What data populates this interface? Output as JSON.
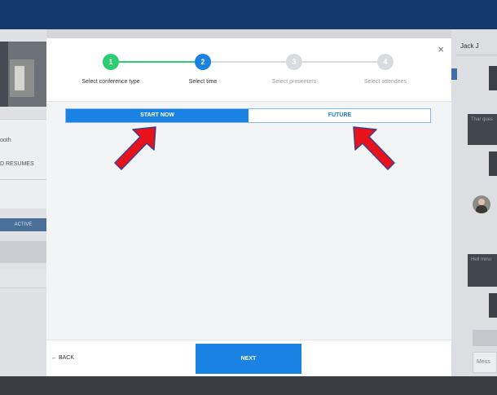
{
  "modal": {
    "close_glyph": "×",
    "steps": [
      {
        "number": "1",
        "label": "Select conference type",
        "state": "done"
      },
      {
        "number": "2",
        "label": "Select time",
        "state": "active"
      },
      {
        "number": "3",
        "label": "Select presenters",
        "state": "pending"
      },
      {
        "number": "4",
        "label": "Select attendees",
        "state": "pending"
      }
    ],
    "toggle": {
      "start_now": "START NOW",
      "future": "FUTURE",
      "selected": "START NOW"
    },
    "footer": {
      "back_label": "← BACK",
      "next_label": "NEXT"
    }
  },
  "background": {
    "left": {
      "text1": "ooth",
      "text2": "D RESUMES",
      "active_label": "ACTIVE"
    },
    "right": {
      "name": "Jack J",
      "message1": "Thar ques",
      "message2": "Hell minu",
      "input_placeholder": "Mess"
    }
  },
  "colors": {
    "primary": "#1a82e2",
    "done": "#2ecc71",
    "pending": "#d9dcdf",
    "arrow_fill": "#e8121a",
    "arrow_stroke": "#3b3f8e",
    "topbar": "#143a6b"
  },
  "annotations": {
    "arrows": [
      {
        "icon": "red-arrow-icon",
        "points_to": "START NOW"
      },
      {
        "icon": "red-arrow-icon",
        "points_to": "FUTURE"
      }
    ]
  }
}
